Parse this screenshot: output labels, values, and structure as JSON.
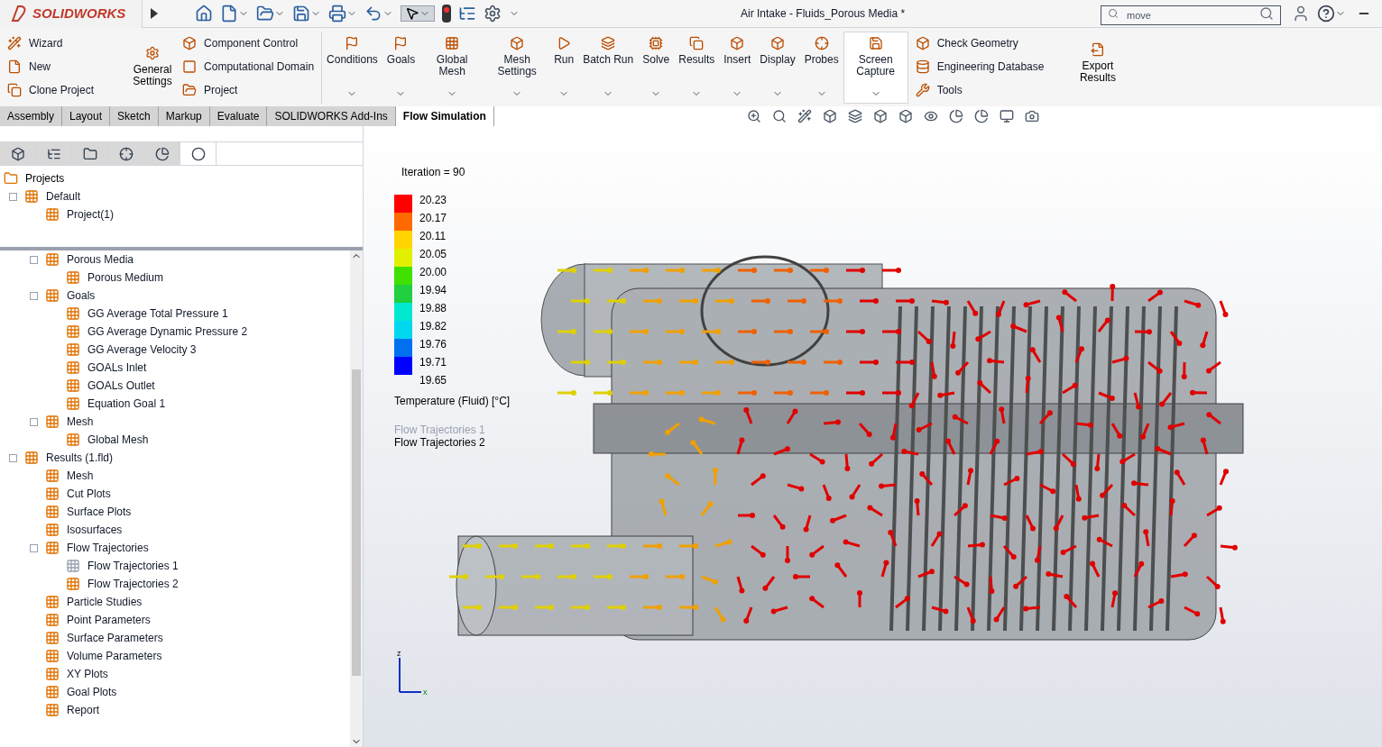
{
  "app": {
    "logo": "SOLIDWORKS",
    "title": "Air Intake - Fluids_Porous Media *",
    "search": {
      "value": "move"
    }
  },
  "ribbon": {
    "left_small": [
      {
        "label": "Wizard"
      },
      {
        "label": "New"
      },
      {
        "label": "Clone Project"
      }
    ],
    "general": {
      "label": "General Settings"
    },
    "mid_small": [
      {
        "label": "Component Control"
      },
      {
        "label": "Computational Domain"
      },
      {
        "label": "Project"
      }
    ],
    "large": [
      {
        "label": "Conditions",
        "selected": false
      },
      {
        "label": "Goals",
        "selected": false
      },
      {
        "label": "Global Mesh",
        "selected": false
      },
      {
        "label": "Mesh Settings",
        "selected": false
      },
      {
        "label": "Run",
        "selected": false
      },
      {
        "label": "Batch Run",
        "selected": false
      },
      {
        "label": "Solve",
        "selected": false
      },
      {
        "label": "Results",
        "selected": false
      },
      {
        "label": "Insert",
        "selected": false
      },
      {
        "label": "Display",
        "selected": false
      },
      {
        "label": "Probes",
        "selected": false
      },
      {
        "label": "Screen Capture",
        "selected": true
      }
    ],
    "right_small": [
      {
        "label": "Check Geometry"
      },
      {
        "label": "Engineering Database"
      },
      {
        "label": "Tools"
      }
    ],
    "export": {
      "label": "Export Results"
    }
  },
  "tabs": [
    {
      "label": "Assembly",
      "selected": false
    },
    {
      "label": "Layout",
      "selected": false
    },
    {
      "label": "Sketch",
      "selected": false
    },
    {
      "label": "Markup",
      "selected": false
    },
    {
      "label": "Evaluate",
      "selected": false
    },
    {
      "label": "SOLIDWORKS Add-Ins",
      "selected": false
    },
    {
      "label": "Flow Simulation",
      "selected": true
    }
  ],
  "panel_tabs": [
    {
      "selected": false
    },
    {
      "selected": false
    },
    {
      "selected": false
    },
    {
      "selected": false
    },
    {
      "selected": false
    },
    {
      "selected": true
    }
  ],
  "projects_tree": {
    "label": "Projects",
    "children": [
      {
        "label": "Default",
        "children": [
          {
            "label": "Project(1)"
          }
        ]
      }
    ]
  },
  "analysis_tree": {
    "scrolled_children": [
      {
        "label": "Porous Media",
        "hidden": false,
        "children": [
          {
            "label": "Porous Medium",
            "hidden": false
          }
        ]
      },
      {
        "label": "Goals",
        "hidden": false,
        "children": [
          {
            "label": "GG Average Total Pressure 1",
            "hidden": false
          },
          {
            "label": "GG Average Dynamic Pressure 2",
            "hidden": false
          },
          {
            "label": "GG Average Velocity 3",
            "hidden": false
          },
          {
            "label": "GOALs Inlet",
            "hidden": false
          },
          {
            "label": "GOALs Outlet",
            "hidden": false
          },
          {
            "label": "Equation Goal 1",
            "hidden": false
          }
        ]
      },
      {
        "label": "Mesh",
        "hidden": false,
        "children": [
          {
            "label": "Global Mesh",
            "hidden": false
          }
        ]
      }
    ],
    "nodes": [
      {
        "label": "Results (1.fld)",
        "hidden": false,
        "children": [
          {
            "label": "Mesh",
            "hidden": false
          },
          {
            "label": "Cut Plots",
            "hidden": false
          },
          {
            "label": "Surface Plots",
            "hidden": false
          },
          {
            "label": "Isosurfaces",
            "hidden": false
          },
          {
            "label": "Flow Trajectories",
            "hidden": false,
            "children": [
              {
                "label": "Flow Trajectories 1",
                "hidden": true
              },
              {
                "label": "Flow Trajectories 2",
                "hidden": false
              }
            ]
          },
          {
            "label": "Particle Studies",
            "hidden": false
          },
          {
            "label": "Point Parameters",
            "hidden": false
          },
          {
            "label": "Surface Parameters",
            "hidden": false
          },
          {
            "label": "Volume Parameters",
            "hidden": false
          },
          {
            "label": "XY Plots",
            "hidden": false
          },
          {
            "label": "Goal Plots",
            "hidden": false
          },
          {
            "label": "Report",
            "hidden": false
          }
        ]
      }
    ]
  },
  "viewport": {
    "iteration": "Iteration = 90",
    "legend": {
      "title": "Temperature (Fluid) [°C]",
      "ticks": [
        "20.23",
        "20.17",
        "20.11",
        "20.05",
        "20.00",
        "19.94",
        "19.88",
        "19.82",
        "19.76",
        "19.71",
        "19.65"
      ],
      "bands": [
        {
          "color": "#ff0000"
        },
        {
          "color": "#ff6a00"
        },
        {
          "color": "#ffd400"
        },
        {
          "color": "#e0f000"
        },
        {
          "color": "#40e000"
        },
        {
          "color": "#20d040"
        },
        {
          "color": "#00e8d0"
        },
        {
          "color": "#00d8f0"
        },
        {
          "color": "#0070f0"
        },
        {
          "color": "#0000ff"
        }
      ]
    },
    "plots": [
      {
        "label": "Flow Trajectories 1",
        "hidden": true
      },
      {
        "label": "Flow Trajectories 2",
        "hidden": false
      }
    ],
    "triad": {
      "z": "z",
      "x": "x"
    }
  }
}
